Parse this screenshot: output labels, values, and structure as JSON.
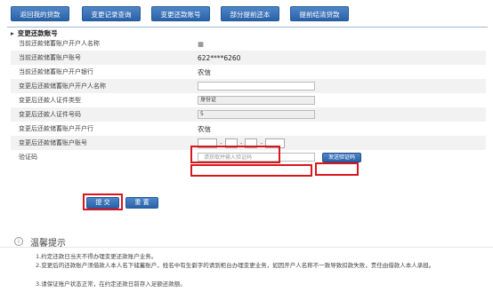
{
  "toolbar": {
    "buttons": [
      {
        "label": "返回我的贷款"
      },
      {
        "label": "变更记录查询"
      },
      {
        "label": "变更还款账号"
      },
      {
        "label": "部分提前还本"
      },
      {
        "label": "提前结清贷款"
      }
    ]
  },
  "section": {
    "title": "变更还款账号"
  },
  "rows": [
    {
      "label": "当前还款储蓄账户开户人名称",
      "value": "■"
    },
    {
      "label": "当前还款储蓄账户账号",
      "value": "622****6260"
    },
    {
      "label": "当前还款储蓄账户开户银行",
      "value": "农信"
    },
    {
      "label": "变更后还款储蓄账户开户人名称",
      "value": ""
    },
    {
      "label": "变更后还款人证件类型",
      "value": "身份证"
    },
    {
      "label": "变更后还款人证件号码",
      "value": "5"
    },
    {
      "label": "变更后还款储蓄账户开户行",
      "value": "农信"
    },
    {
      "label": "变更后还款储蓄账户账号",
      "value": ""
    },
    {
      "label": "验证码",
      "placeholder": "请获取并输入验证码"
    }
  ],
  "sms_button": {
    "label": "发送验证码"
  },
  "actions": {
    "submit": "提 交",
    "reset": "重 置"
  },
  "tips": {
    "title": "温馨提示",
    "icon": "info-icon",
    "items": [
      "1.约定还款日当天不得办理变更还款账户业务。",
      "2.变更后的还款账户须借款人本人名下储蓄账户，姓名中有生僻字的请到柜台办理变更业务，如因开户人名称不一致导致扣款失败，责任由借款人本人承担。",
      "3.请保证账户状态正常，在约定还款日前存入足额还款额。"
    ]
  },
  "colors": {
    "accent": "#2a62a8",
    "highlight": "#d9161d"
  }
}
